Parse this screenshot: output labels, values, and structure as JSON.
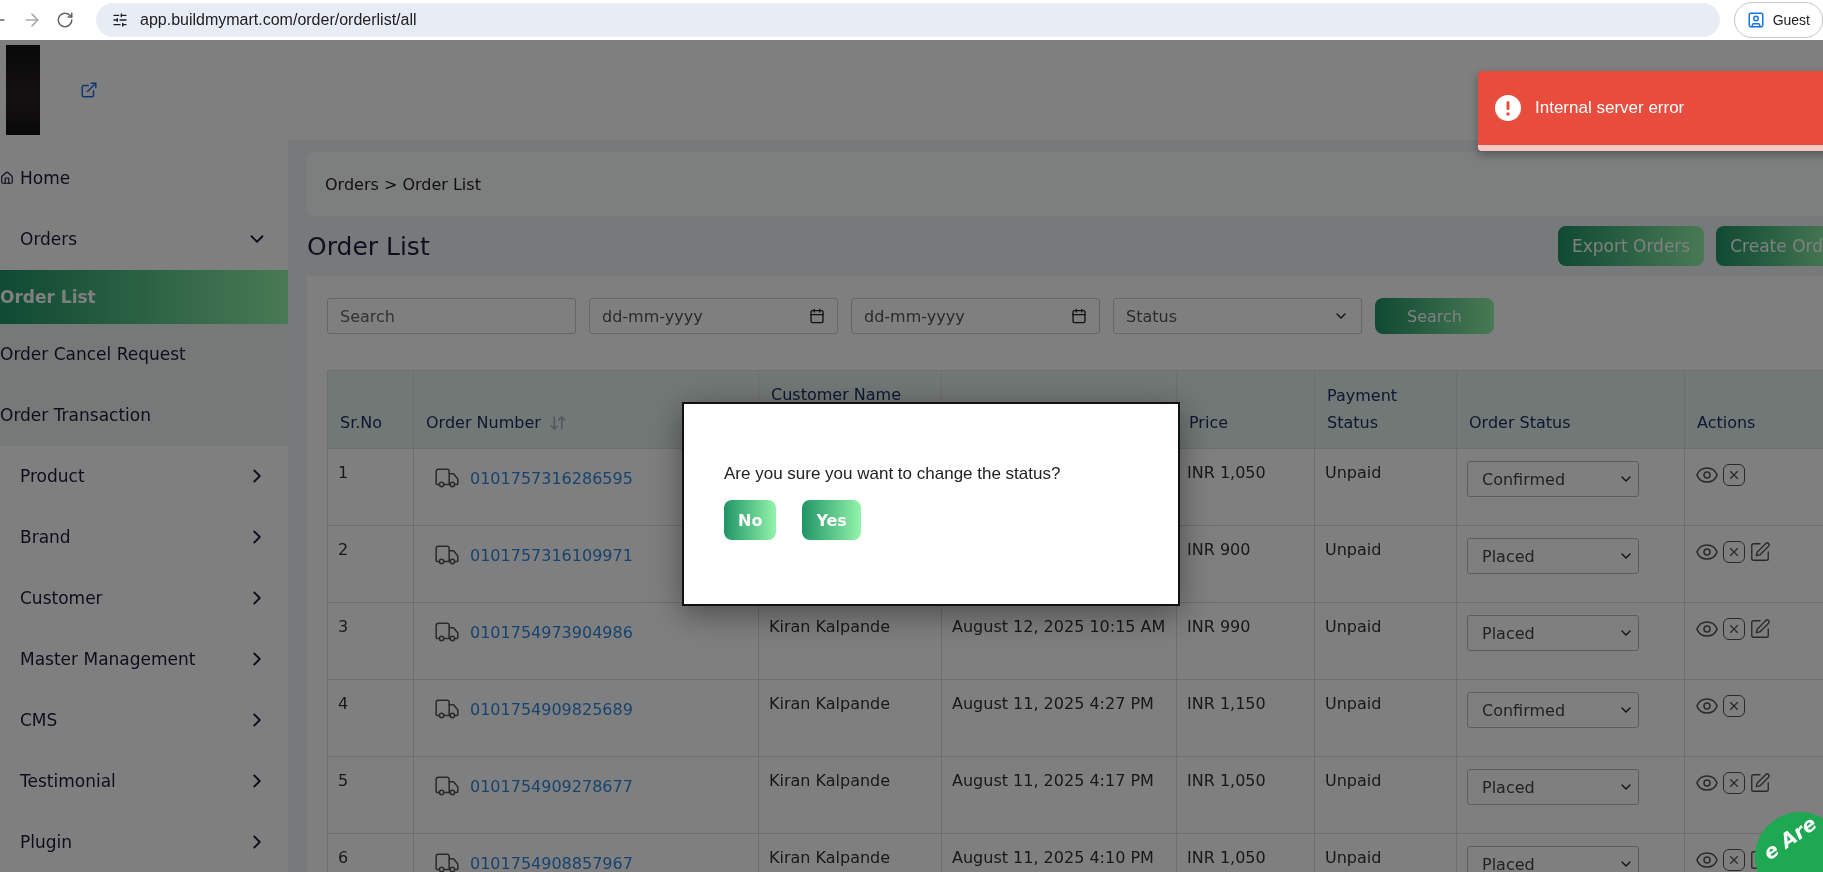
{
  "browser": {
    "url": "app.buildmymart.com/order/orderlist/all",
    "profile": "Guest"
  },
  "sidebar": {
    "items": [
      {
        "label": "Home",
        "kind": "link",
        "selected": false
      },
      {
        "label": "Orders",
        "kind": "group",
        "expanded": true,
        "selected": false,
        "children": [
          {
            "label": "Order List",
            "selected": true
          },
          {
            "label": "Order Cancel Request",
            "selected": false
          },
          {
            "label": "Order Transaction",
            "selected": false
          }
        ]
      },
      {
        "label": "Product",
        "kind": "group",
        "expanded": false,
        "selected": false
      },
      {
        "label": "Brand",
        "kind": "group",
        "expanded": false,
        "selected": false
      },
      {
        "label": "Customer",
        "kind": "group",
        "expanded": false,
        "selected": false
      },
      {
        "label": "Master Management",
        "kind": "group",
        "expanded": false,
        "selected": false
      },
      {
        "label": "CMS",
        "kind": "group",
        "expanded": false,
        "selected": false
      },
      {
        "label": "Testimonial",
        "kind": "group",
        "expanded": false,
        "selected": false
      },
      {
        "label": "Plugin",
        "kind": "group",
        "expanded": false,
        "selected": false
      }
    ]
  },
  "breadcrumb": "Orders > Order List",
  "page_title": "Order List",
  "header_buttons": [
    "Export Orders",
    "Create Ord"
  ],
  "filters": {
    "search": {
      "placeholder": "Search"
    },
    "date_from": {
      "placeholder": "dd-mm-yyyy"
    },
    "date_to": {
      "placeholder": "dd-mm-yyyy"
    },
    "status": {
      "value": "Status"
    },
    "button": "Search"
  },
  "table": {
    "columns": [
      {
        "label": "Sr.No"
      },
      {
        "label": "Order Number",
        "sortable": true
      },
      {
        "label": "Customer Name"
      },
      {},
      {
        "label": "Price"
      },
      {
        "label": "Payment Status"
      },
      {
        "label": "Order Status"
      },
      {
        "label": "Actions"
      }
    ],
    "rows": [
      {
        "sr": "1",
        "order_number": "0101757316286595",
        "price": "INR 1,050",
        "payment": "Unpaid",
        "status": "Confirmed",
        "actions": [
          {
            "kind": "view"
          },
          {
            "kind": "cancel"
          }
        ]
      },
      {
        "sr": "2",
        "order_number": "0101757316109971",
        "price": "INR 900",
        "payment": "Unpaid",
        "status": "Placed",
        "actions": [
          {
            "kind": "view"
          },
          {
            "kind": "cancel"
          },
          {
            "kind": "edit"
          }
        ]
      },
      {
        "sr": "3",
        "order_number": "0101754973904986",
        "customer": "Kiran Kalpande",
        "date": "August 12, 2025 10:15 AM",
        "price": "INR 990",
        "payment": "Unpaid",
        "status": "Placed",
        "actions": [
          {
            "kind": "view"
          },
          {
            "kind": "cancel"
          },
          {
            "kind": "edit"
          }
        ]
      },
      {
        "sr": "4",
        "order_number": "0101754909825689",
        "customer": "Kiran Kalpande",
        "date": "August 11, 2025 4:27 PM",
        "price": "INR 1,150",
        "payment": "Unpaid",
        "status": "Confirmed",
        "actions": [
          {
            "kind": "view"
          },
          {
            "kind": "cancel"
          }
        ]
      },
      {
        "sr": "5",
        "order_number": "0101754909278677",
        "customer": "Kiran Kalpande",
        "date": "August 11, 2025 4:17 PM",
        "price": "INR 1,050",
        "payment": "Unpaid",
        "status": "Placed",
        "actions": [
          {
            "kind": "view"
          },
          {
            "kind": "cancel"
          },
          {
            "kind": "edit"
          }
        ]
      },
      {
        "sr": "6",
        "order_number": "0101754908857967",
        "customer": "Kiran Kalpande",
        "date": "August 11, 2025 4:10 PM",
        "price": "INR 1,050",
        "payment": "Unpaid",
        "status": "Placed",
        "actions": [
          {
            "kind": "view"
          },
          {
            "kind": "cancel"
          },
          {
            "kind": "edit"
          }
        ]
      }
    ]
  },
  "dialog": {
    "message": "Are you sure you want to change the status?",
    "buttons": [
      "No",
      "Yes"
    ]
  },
  "toast": {
    "message": "Internal server error",
    "level": 1
  },
  "chat_badge": {
    "label": "e Are"
  }
}
